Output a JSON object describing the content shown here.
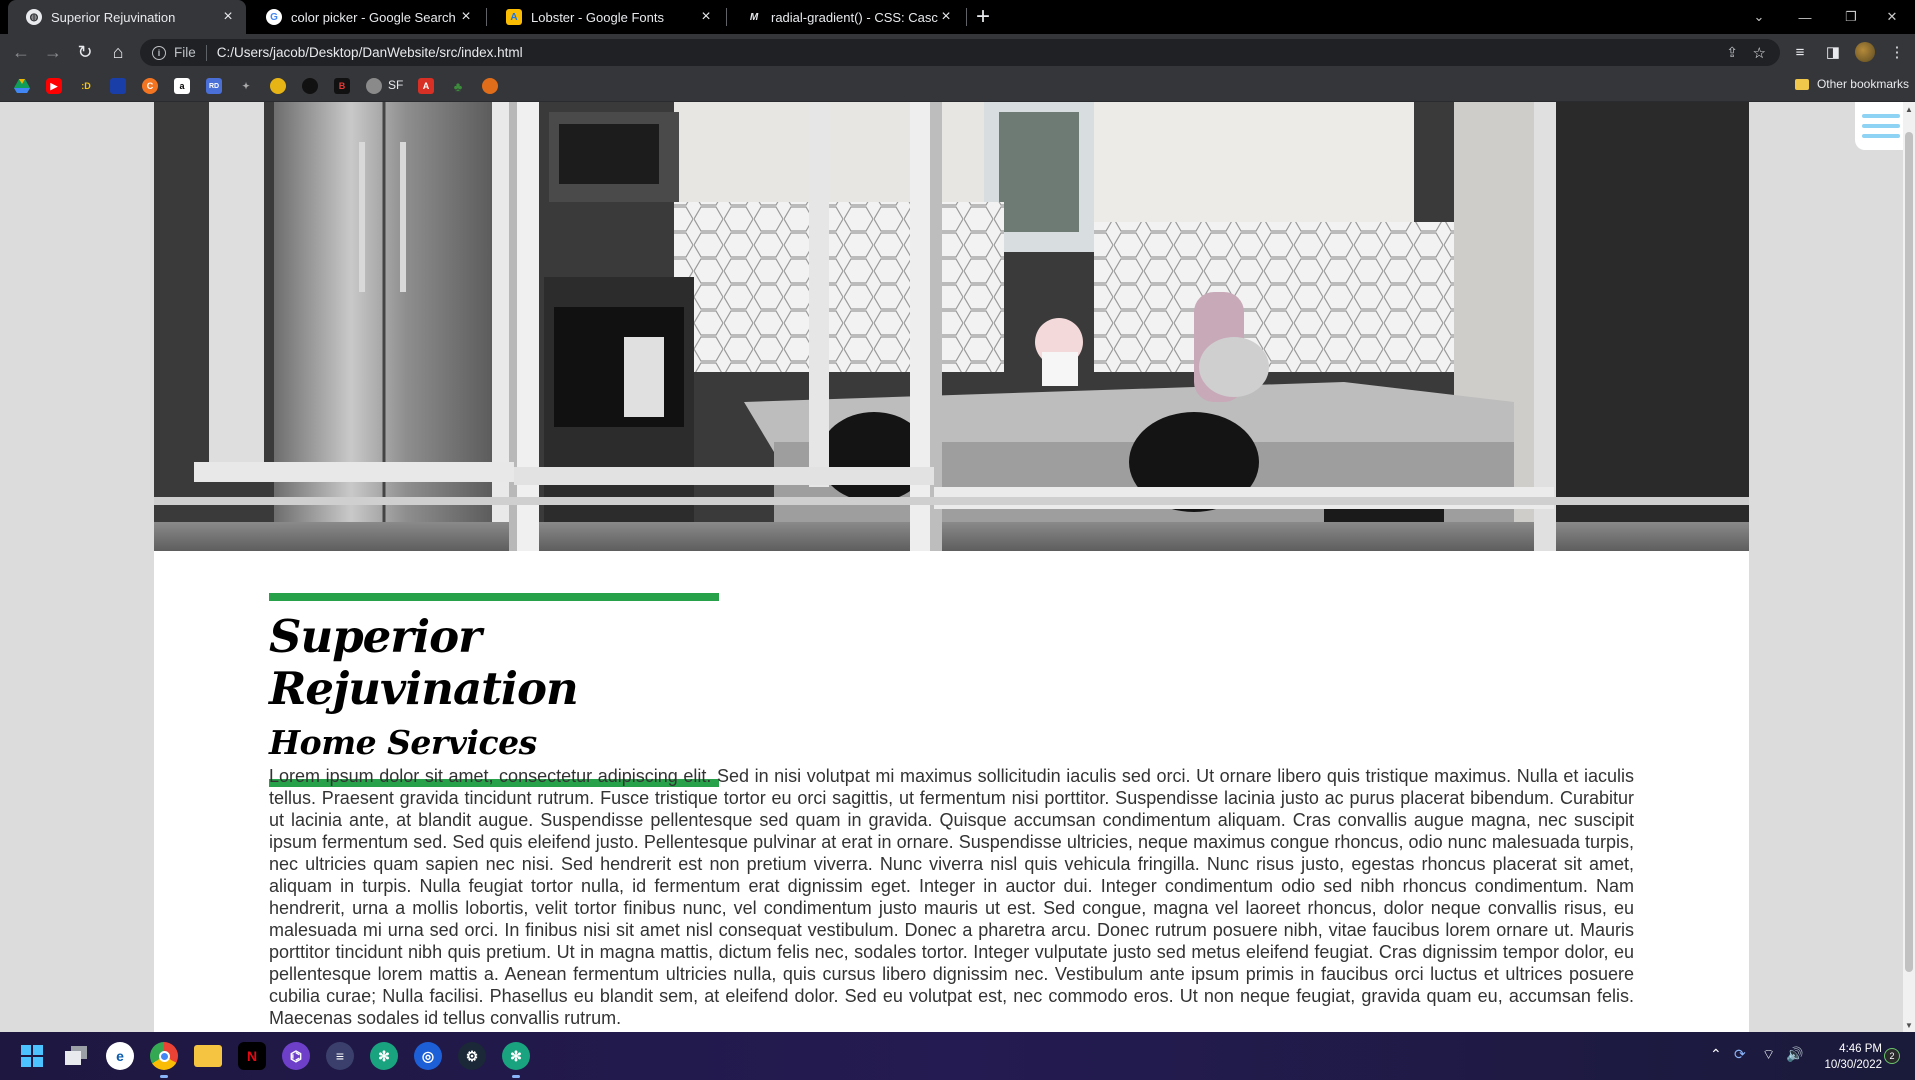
{
  "browser": {
    "tabs": [
      {
        "label": "Superior Rejuvination",
        "active": true,
        "icon": "globe-icon"
      },
      {
        "label": "color picker - Google Search",
        "active": false,
        "icon": "google-icon"
      },
      {
        "label": "Lobster - Google Fonts",
        "active": false,
        "icon": "google-fonts-icon"
      },
      {
        "label": "radial-gradient() - CSS: Cascading",
        "active": false,
        "icon": "mdn-icon"
      }
    ],
    "omnibox": {
      "scheme_label": "File",
      "url": "C:/Users/jacob/Desktop/DanWebsite/src/index.html"
    },
    "bookmarks": {
      "items": [
        {
          "icon": "google-drive-icon",
          "color": "#f4b400",
          "text": ""
        },
        {
          "icon": "youtube-icon",
          "color": "#ff0000",
          "text": ""
        },
        {
          "icon": "d-icon",
          "color": "#f5c518",
          "text": ":D"
        },
        {
          "icon": "bookmark-blue-icon",
          "color": "#1a3ea8",
          "text": ""
        },
        {
          "icon": "crunchyroll-icon",
          "color": "#f47521",
          "text": ""
        },
        {
          "icon": "amazon-icon",
          "color": "#ffffff",
          "text": "a"
        },
        {
          "icon": "rally-data-icon",
          "color": "#4a6fd6",
          "text": "RD"
        },
        {
          "icon": "bookmark-dark-icon",
          "color": "#555555",
          "text": ""
        },
        {
          "icon": "bookmark-yellow-icon",
          "color": "#e7b416",
          "text": ""
        },
        {
          "icon": "bookmark-black-icon",
          "color": "#222222",
          "text": ""
        },
        {
          "icon": "b-icon",
          "color": "#c00000",
          "text": "B"
        },
        {
          "icon": "sf-icon",
          "color": "#8a8a8a",
          "text": ""
        },
        {
          "icon": "bookmark-red-icon",
          "color": "#d93025",
          "text": ""
        },
        {
          "icon": "bookmark-green-icon",
          "color": "#3c8c3c",
          "text": ""
        },
        {
          "icon": "bookmark-orange-icon",
          "color": "#e06d1a",
          "text": ""
        }
      ],
      "sf_label": "SF",
      "other_label": "Other bookmarks"
    }
  },
  "page": {
    "title": "Superior Rejuvination",
    "subtitle": "Home Services",
    "accent_color": "#27a14a",
    "hero_image": "kitchen-photo",
    "body": "Lorem ipsum dolor sit amet, consectetur adipiscing elit. Sed in nisi volutpat mi maximus sollicitudin iaculis sed orci. Ut ornare libero quis tristique maximus. Nulla et iaculis tellus. Praesent gravida tincidunt rutrum. Fusce tristique tortor eu orci sagittis, ut fermentum nisi porttitor. Suspendisse lacinia justo ac purus placerat bibendum. Curabitur ut lacinia ante, at blandit augue. Suspendisse pellentesque sed quam in gravida. Quisque accumsan condimentum aliquam. Cras convallis augue magna, nec suscipit ipsum fermentum sed. Sed quis eleifend justo. Pellentesque pulvinar at erat in ornare. Suspendisse ultricies, neque maximus congue rhoncus, odio nunc malesuada turpis, nec ultricies quam sapien nec nisi. Sed hendrerit est non pretium viverra. Nunc viverra nisl quis vehicula fringilla. Nunc risus justo, egestas rhoncus placerat sit amet, aliquam in turpis. Nulla feugiat tortor nulla, id fermentum erat dignissim eget. Integer in auctor dui. Integer condimentum odio sed nibh rhoncus condimentum. Nam hendrerit, urna a mollis lobortis, velit tortor finibus nunc, vel condimentum justo mauris ut est. Sed congue, magna vel laoreet rhoncus, dolor neque convallis risus, eu malesuada mi urna sed orci. In finibus nisi sit amet nisl consequat vestibulum. Donec a pharetra arcu. Donec rutrum posuere nibh, vitae faucibus lorem ornare ut. Mauris porttitor tincidunt nibh quis pretium. Ut in magna mattis, dictum felis nec, sodales tortor. Integer vulputate justo sed metus eleifend feugiat. Cras dignissim tempor dolor, eu pellentesque lorem mattis a. Aenean fermentum ultricies nulla, quis cursus libero dignissim nec. Vestibulum ante ipsum primis in faucibus orci luctus et ultrices posuere cubilia curae; Nulla facilisi. Phasellus eu blandit sem, at eleifend dolor. Sed eu volutpat est, nec commodo eros. Ut non neque feugiat, gravida quam eu, accumsan felis. Maecenas sodales id tellus convallis rutrum."
  },
  "taskbar": {
    "time": "4:46 PM",
    "date": "10/30/2022",
    "notification_count": "2",
    "apps": [
      "windows-start-icon",
      "task-view-icon",
      "edge-icon",
      "chrome-icon",
      "file-explorer-icon",
      "netflix-icon",
      "github-icon",
      "terminal-icon",
      "chatgpt-icon",
      "ubisoft-icon",
      "steam-icon",
      "chatgpt-icon-2"
    ]
  }
}
